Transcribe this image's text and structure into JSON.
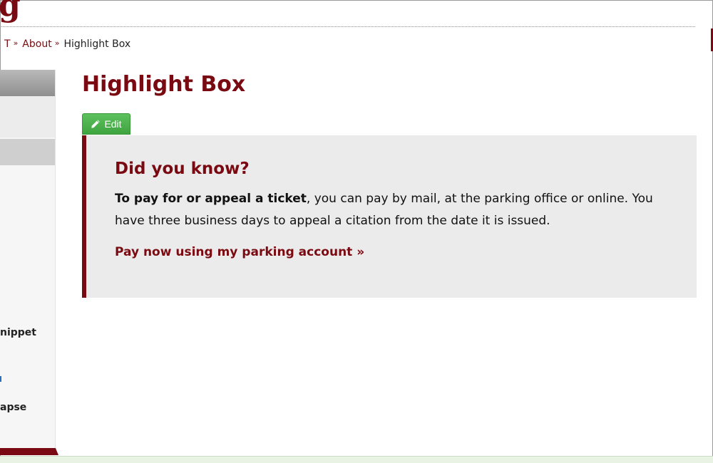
{
  "header": {
    "logo_fragment": "g"
  },
  "breadcrumb": {
    "items": [
      {
        "label": "T",
        "link": true
      },
      {
        "label": "About",
        "link": true
      },
      {
        "label": "Highlight Box",
        "link": false
      }
    ],
    "separator": "»"
  },
  "sidebar": {
    "partial_items": [
      "nippet",
      "apse"
    ]
  },
  "page": {
    "title": "Highlight Box",
    "edit_label": "Edit"
  },
  "highlight_box": {
    "heading": "Did you know?",
    "lead_bold": "To pay for or appeal a ticket",
    "body": ", you can pay by mail, at the parking office or online. You have three business days to appeal a citation from the date it is issued.",
    "link_label": "Pay now using my parking account »"
  },
  "colors": {
    "brand": "#7a0a12",
    "edit_button": "#4cb34c",
    "box_background": "#ebebeb"
  }
}
